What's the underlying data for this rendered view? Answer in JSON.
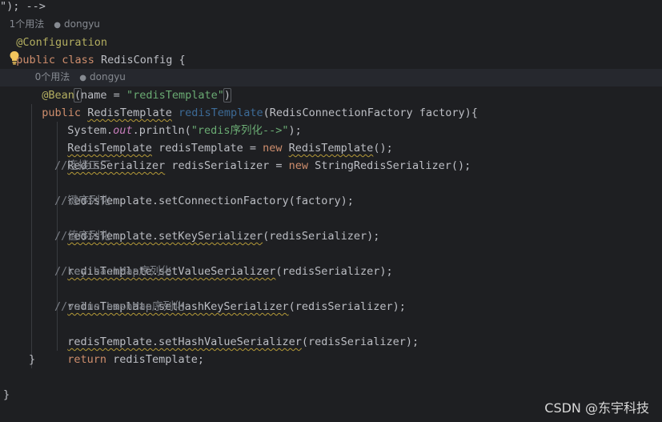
{
  "hints": {
    "top_usages": "1个用法",
    "top_author": "dongyu",
    "method_usages": "0个用法",
    "method_author": "dongyu"
  },
  "code": {
    "annotation_configuration": "@Configuration",
    "kw_public": "public",
    "kw_class": "class",
    "class_name": "RedisConfig",
    "open_brace": " {",
    "bean_annotation": "@Bean",
    "bean_open": "(",
    "bean_param": "name = ",
    "bean_value": "\"redisTemplate\"",
    "bean_close": ")",
    "method_return_type": "RedisTemplate",
    "method_name": "redisTemplate",
    "method_params": "(RedisConnectionFactory factory){",
    "l1_system": "System.",
    "l1_out": "out",
    "l1_println": ".println(",
    "l1_string": "\"redis序列化-->\"",
    "l1_end": ");",
    "l2_type": "RedisTemplate",
    "l2_mid": " redisTemplate = ",
    "l2_new": "new",
    "l2_space": " ",
    "l2_ctor": "RedisTemplate",
    "l2_end": "();",
    "l3_type": "RedisSerializer",
    "l3_mid": " redisSerializer = ",
    "l3_new": "new",
    "l3_ctor": " StringRedisSerializer();",
    "c1": "//连接工厂",
    "l4": "redisTemplate.setConnectionFactory(factory);",
    "c2": "//键序列化",
    "l5_warn": "redisTemplate.setKeySerializer",
    "l5_end": "(redisSerializer);",
    "c3": "//值序列化",
    "l6_warn": "redisTemplate.setValueSerializer",
    "l6_end": "(redisSerializer);",
    "c4": "//key hashMap序列化",
    "l7_warn": "redisTemplate.setHashKeySerializer",
    "l7_end": "(redisSerializer);",
    "c5": "//value hashMap序列化",
    "l8_warn": "redisTemplate.setHashValueSerializer",
    "l8_end": "(redisSerializer);",
    "ret_kw": "return",
    "ret_val": " redisTemplate;",
    "method_close": "}",
    "class_close": "}"
  },
  "icons": {
    "intention": "lightbulb-icon",
    "author": "user-icon"
  },
  "watermark": "CSDN @东宇科技",
  "colors": {
    "background": "#1e1f22",
    "keyword": "#cf8e6d",
    "annotation": "#b3ae60",
    "string": "#6aab73",
    "comment": "#7a7e85",
    "static_field": "#c77dbb",
    "text": "#bcbec4",
    "warning_underline": "#b59a38",
    "bulb": "#f2c55c"
  }
}
